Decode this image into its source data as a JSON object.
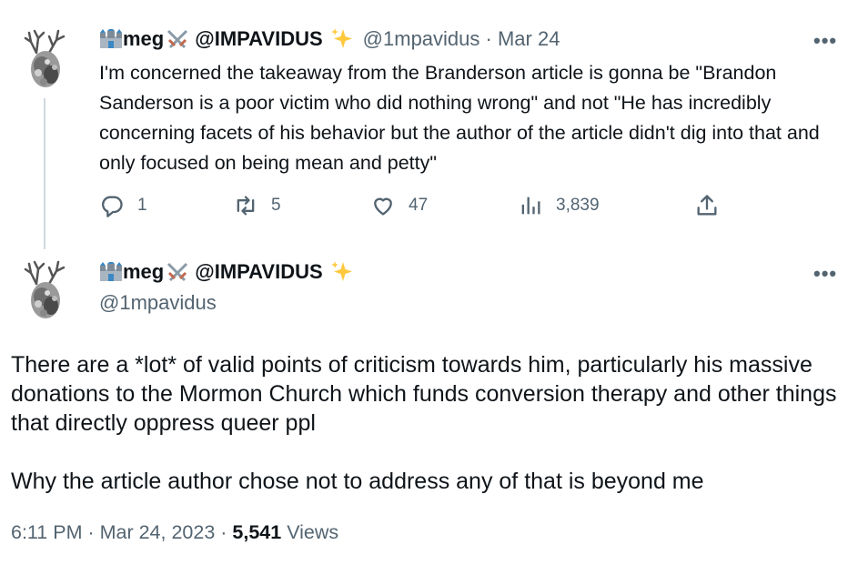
{
  "tweet1": {
    "display_name": "meg",
    "username": "@IMPAVIDUS",
    "handle": "@1mpavidus",
    "separator": " · ",
    "date": "Mar 24",
    "text": "I'm concerned the takeaway from the Branderson article is gonna be \"Brandon Sanderson is a poor victim who did nothing wrong\" and not \"He has incredibly concerning facets of his behavior but the author of the article didn't dig into that and only focused on being mean and petty\"",
    "more_label": "•••",
    "actions": {
      "replies": "1",
      "retweets": "5",
      "likes": "47",
      "views": "3,839"
    }
  },
  "tweet2": {
    "display_name": "meg",
    "username": "@IMPAVIDUS",
    "handle": "@1mpavidus",
    "more_label": "•••",
    "paragraph1": "There are a *lot* of valid points of criticism towards him, particularly his massive donations to the Mormon Church which funds conversion therapy and other things that directly oppress queer ppl",
    "paragraph2": "Why the article author chose not to address any of that is beyond me",
    "time": "6:11 PM",
    "date": "Mar 24, 2023",
    "separator": " · ",
    "views_count": "5,541",
    "views_label": " Views"
  },
  "icons": {
    "castle": "castle-emoji-icon",
    "swords": "crossed-swords-emoji-icon",
    "sparkles": "sparkles-emoji-icon",
    "reply": "reply-icon",
    "retweet": "retweet-icon",
    "like": "heart-icon",
    "views": "views-chart-icon",
    "share": "share-icon"
  },
  "colors": {
    "text": "#0f1419",
    "secondary": "#536471",
    "thread_line": "#cfd9de",
    "sparkle": "#ffc83d"
  }
}
